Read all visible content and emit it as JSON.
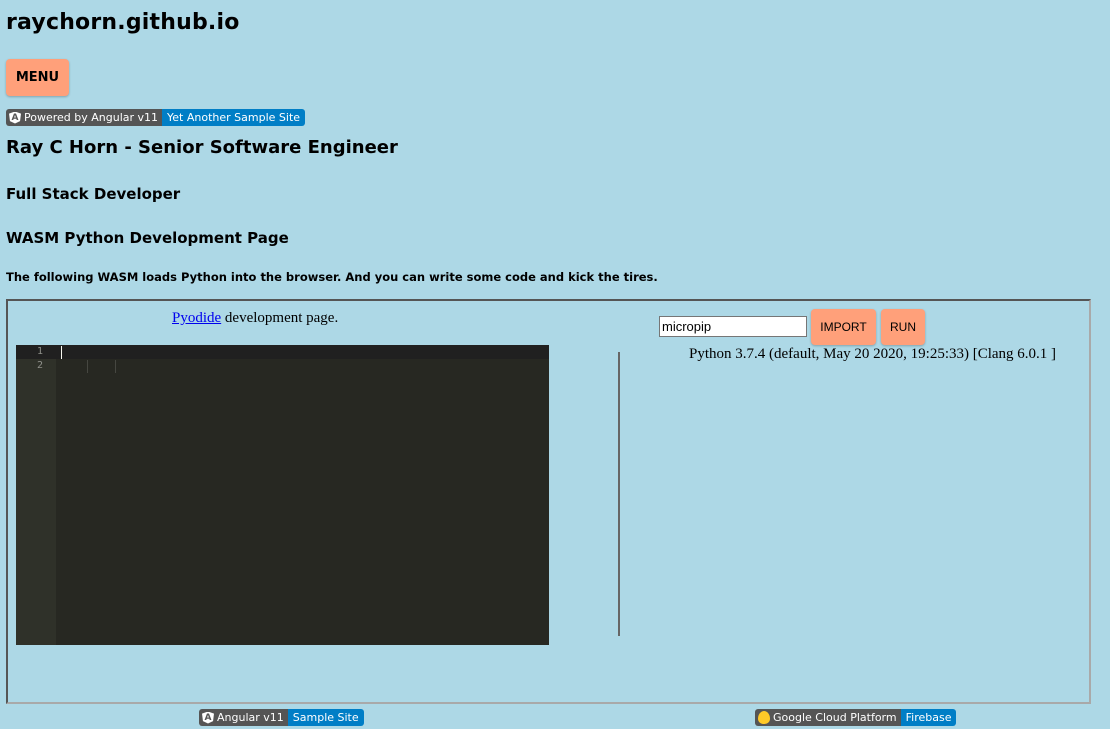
{
  "site": {
    "title": "raychorn.github.io",
    "menu_label": "MENU"
  },
  "badges": {
    "top": {
      "left": "Powered by Angular v11",
      "right": "Yet Another Sample Site",
      "left_icon": "angular-icon"
    },
    "bottom_left": {
      "left": "Angular v11",
      "right": "Sample Site",
      "left_icon": "angular-icon"
    },
    "bottom_right": {
      "left": "Google Cloud Platform",
      "right": "Firebase",
      "left_icon": "firebase-icon"
    }
  },
  "headings": {
    "name": "Ray C Horn - Senior Software Engineer",
    "role": "Full Stack Developer",
    "page": "WASM Python Development Page",
    "intro": "The following WASM loads Python into the browser. And you can write some code and kick the tires."
  },
  "pyodide": {
    "link_text": "Pyodide",
    "suffix": " development page."
  },
  "editor": {
    "line_numbers": [
      "1",
      "2"
    ],
    "theme_bg": "#272822"
  },
  "python_panel": {
    "package_input_value": "micropip",
    "import_label": "IMPORT",
    "run_label": "RUN",
    "version_text": "Python 3.7.4 (default, May 20 2020, 19:25:33) [Clang 6.0.1 ]"
  },
  "colors": {
    "page_bg": "#add8e6",
    "button_bg": "#ffa07a",
    "badge_left": "#555555",
    "badge_right": "#007ec6",
    "link": "#0000ee"
  }
}
